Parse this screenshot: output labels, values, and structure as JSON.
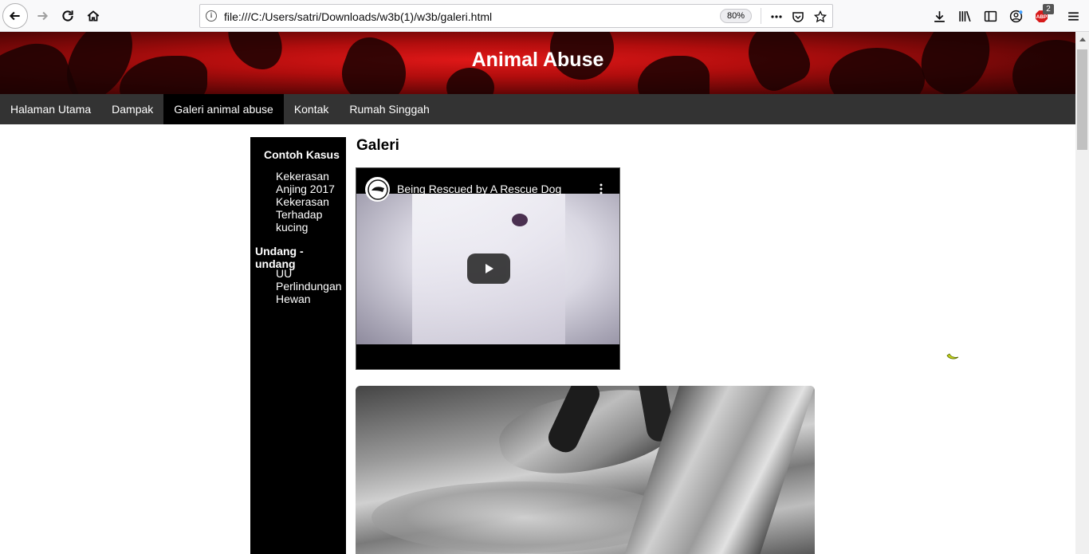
{
  "browser": {
    "url": "file:///C:/Users/satri/Downloads/w3b(1)/w3b/galeri.html",
    "zoom": "80%",
    "adblock_count": "2"
  },
  "page": {
    "site_title": "Animal Abuse",
    "nav": [
      {
        "label": "Halaman Utama"
      },
      {
        "label": "Dampak"
      },
      {
        "label": "Galeri animal abuse",
        "active": true
      },
      {
        "label": "Kontak"
      },
      {
        "label": "Rumah Singgah"
      }
    ],
    "sidebar": {
      "sections": [
        {
          "heading": "Contoh Kasus",
          "items": [
            "Kekerasan Anjing 2017",
            "Kekerasan Terhadap kucing"
          ]
        },
        {
          "heading": "Undang - undang",
          "items": [
            "UU Perlindungan Hewan"
          ]
        }
      ]
    },
    "main": {
      "title": "Galeri",
      "video_title": "Being Rescued by A Rescue Dog"
    }
  },
  "colors": {
    "nav_bg": "#333333",
    "nav_active": "#000000",
    "header_red": "#e01818",
    "sidebar_bg": "#000000"
  }
}
